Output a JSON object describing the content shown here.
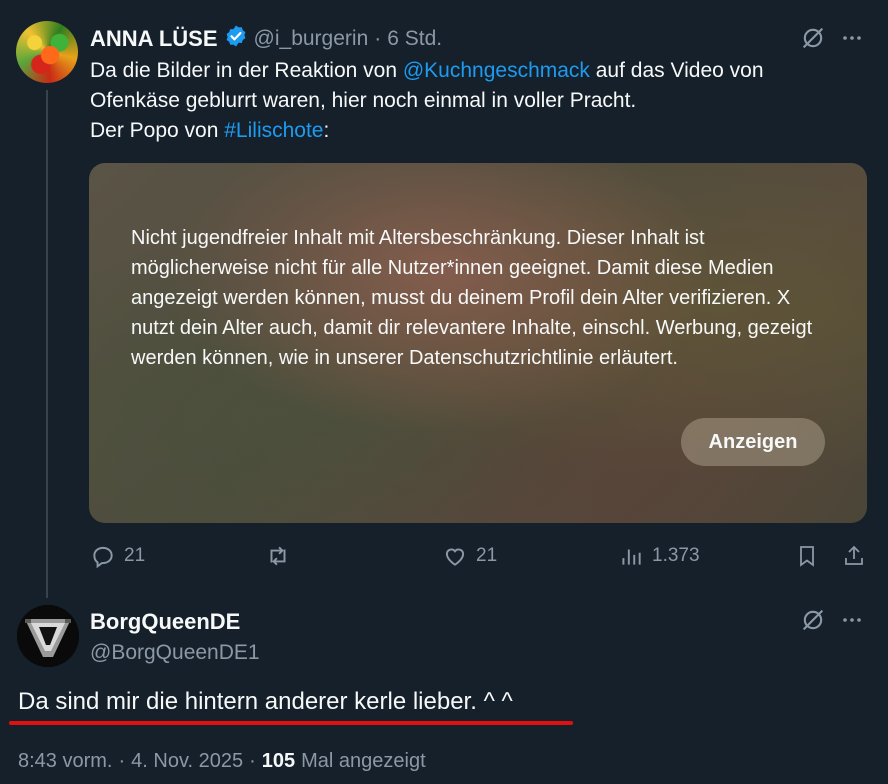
{
  "tweet": {
    "author_name": "ANNA LÜSE",
    "handle": "@i_burgerin",
    "sep": "·",
    "time": "6 Std.",
    "text_part1": "Da die Bilder in der Reaktion von ",
    "mention": "@Kuchngeschmack",
    "text_part2": " auf das Video von",
    "text_line2": "Ofenkäse geblurrt waren, hier noch einmal in voller Pracht.",
    "text_line3_prefix": "Der Popo von ",
    "hashtag": "#Lilischote",
    "text_line3_suffix": ":",
    "media_warning": "Nicht jugendfreier Inhalt mit Altersbeschränkung. Dieser Inhalt ist möglicherweise nicht für alle Nutzer*innen geeignet. Damit diese Medien angezeigt werden können, musst du deinem Profil dein Alter verifizieren. X nutzt dein Alter auch, damit dir relevantere Inhalte, einschl. Werbung, gezeigt werden können, wie in unserer Datenschutzrichtlinie erläutert.",
    "show_button": "Anzeigen",
    "replies": "21",
    "likes": "21",
    "views": "1.373"
  },
  "reply": {
    "author_name": "BorgQueenDE",
    "handle": "@BorgQueenDE1",
    "text": "Da sind mir die hintern anderer kerle lieber. ^ ^",
    "time": "8:43 vorm.",
    "sep1": "·",
    "date": "4. Nov. 2025",
    "sep2": "·",
    "view_count": "105",
    "views_label": "Mal angezeigt"
  },
  "colors": {
    "background": "#15202b",
    "link": "#1d9bf0",
    "muted": "#8b98a5",
    "underline": "#e01010"
  }
}
